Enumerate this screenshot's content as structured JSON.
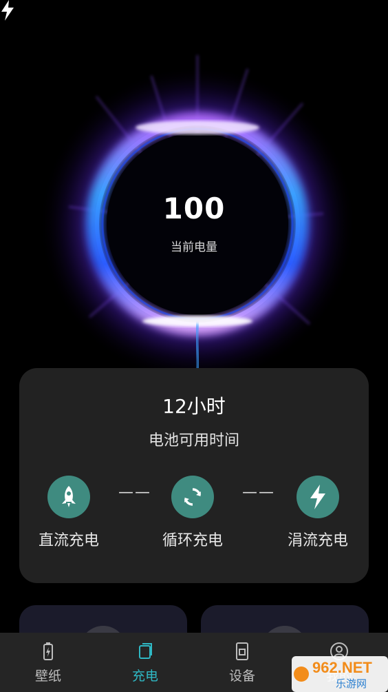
{
  "battery": {
    "value": "100",
    "label": "当前电量"
  },
  "card": {
    "hours": "12小时",
    "hours_label": "电池可用时间",
    "modes": [
      {
        "label": "直流充电",
        "icon": "rocket-icon"
      },
      {
        "label": "循环充电",
        "icon": "sync-icon"
      },
      {
        "label": "涓流充电",
        "icon": "bolt-icon"
      }
    ],
    "separator": "——"
  },
  "nav": {
    "items": [
      {
        "label": "壁纸",
        "icon": "battery-icon",
        "active": false
      },
      {
        "label": "充电",
        "icon": "layers-icon",
        "active": true
      },
      {
        "label": "设备",
        "icon": "device-icon",
        "active": false
      },
      {
        "label": "我的",
        "icon": "user-icon",
        "active": false
      }
    ]
  },
  "watermark": {
    "brand": "962.NET",
    "site": "乐游网"
  },
  "colors": {
    "accent": "#2fb8c4",
    "mode_circle": "#3f8b80",
    "card_bg": "#222222",
    "nav_bg": "#252525"
  }
}
